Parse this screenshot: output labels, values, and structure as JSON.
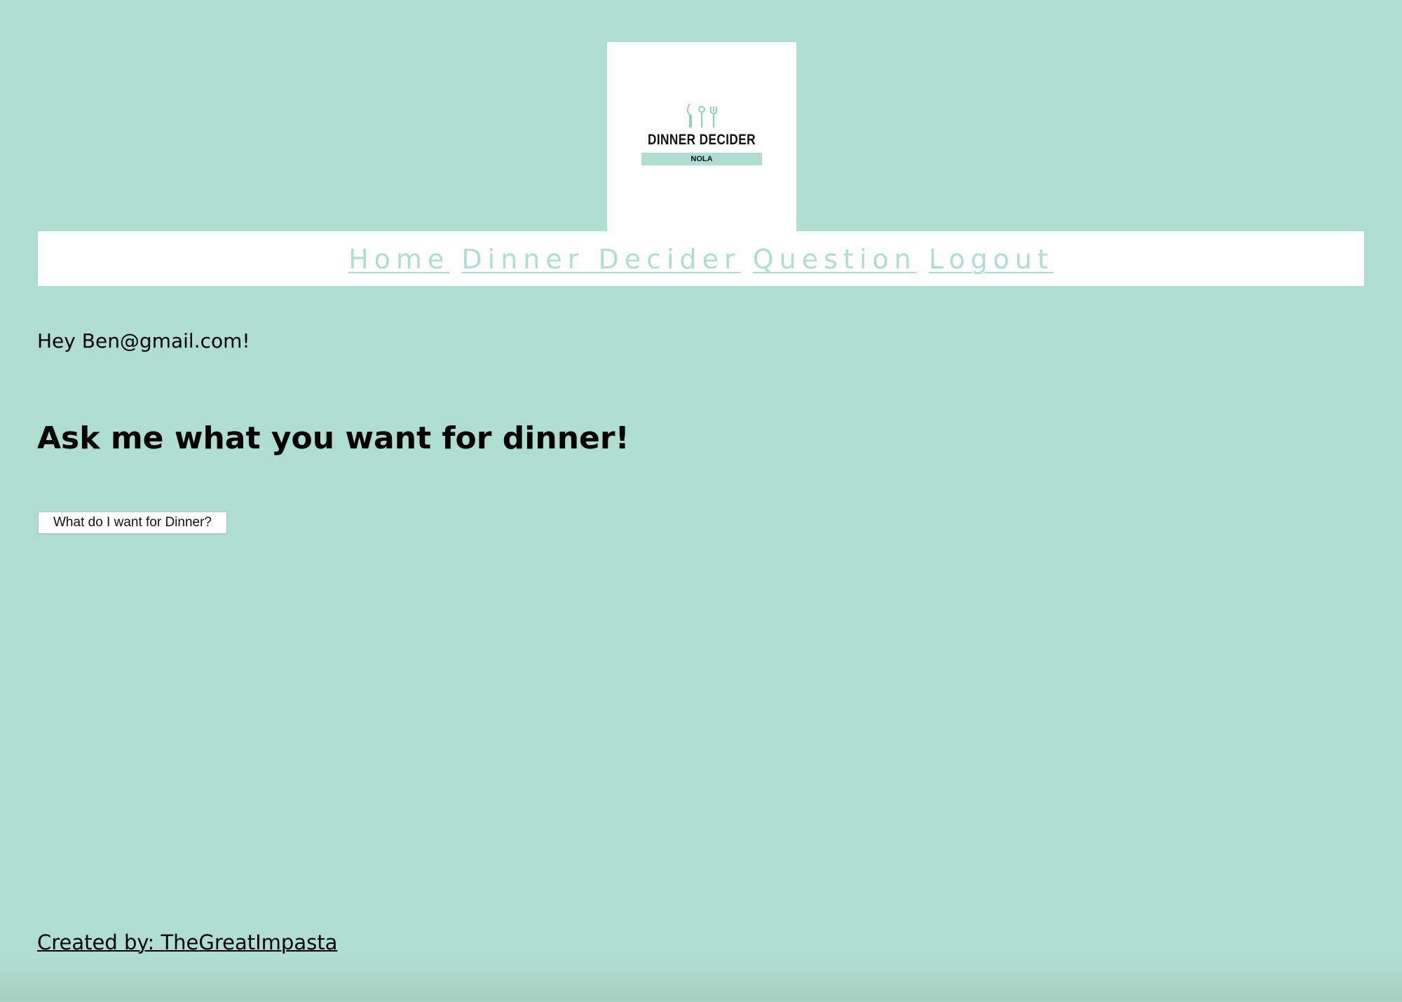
{
  "logo": {
    "title": "DINNER DECIDER",
    "subtitle": "NOLA",
    "icon": "utensils-icon"
  },
  "nav": {
    "items": [
      {
        "label": "Home"
      },
      {
        "label": "Dinner Decider"
      },
      {
        "label": "Question"
      },
      {
        "label": "Logout"
      }
    ]
  },
  "main": {
    "greeting": "Hey Ben@gmail.com!",
    "heading": "Ask me what you want for dinner!",
    "button_label": "What do I want for Dinner?"
  },
  "footer": {
    "credit": "Created by: TheGreatImpasta"
  },
  "colors": {
    "background": "#afddd2",
    "panel": "#ffffff",
    "accent": "#afddd2",
    "text": "#000000"
  }
}
